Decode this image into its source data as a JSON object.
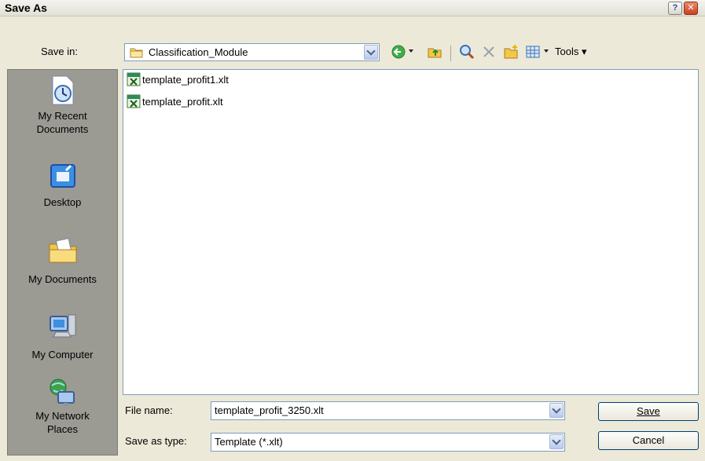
{
  "window": {
    "title": "Save As",
    "help_glyph": "?",
    "close_glyph": "✕"
  },
  "save_in": {
    "label": "Save in:",
    "folder": "Classification_Module"
  },
  "toolbar": {
    "tools_label": "Tools"
  },
  "places": [
    {
      "label": "My Recent Documents"
    },
    {
      "label": "Desktop"
    },
    {
      "label": "My Documents"
    },
    {
      "label": "My Computer"
    },
    {
      "label": "My Network Places"
    }
  ],
  "files": [
    {
      "name": "template_profit1.xlt"
    },
    {
      "name": "template_profit.xlt"
    }
  ],
  "file_name": {
    "label": "File name:",
    "value": "template_profit_3250.xlt"
  },
  "save_as_type": {
    "label": "Save as type:",
    "value": "Template (*.xlt)"
  },
  "buttons": {
    "save": "Save",
    "cancel": "Cancel"
  },
  "colors": {
    "background": "#ece9d8",
    "places_bar": "#9b9a93",
    "border": "#7f9db9"
  }
}
